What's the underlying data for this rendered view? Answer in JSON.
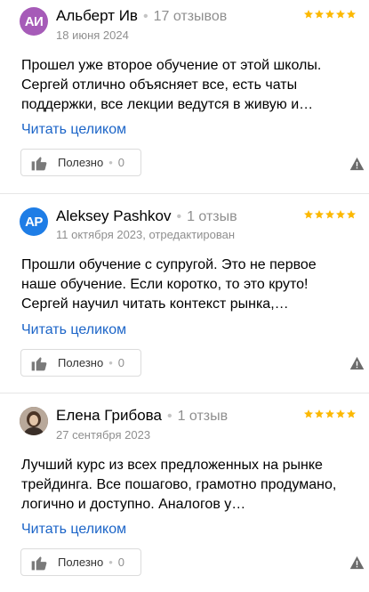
{
  "reviews": [
    {
      "avatar_initials": "АИ",
      "avatar_color": "#a65bb8",
      "author": "Альберт Ив",
      "review_count": "17 отзывов",
      "date": "18 июня 2024",
      "rating": 5,
      "text": "Прошел уже второе обучение от этой школы. Сергей отлично объясняет все, есть чаты поддержки, все лекции ведутся в живую и…",
      "read_more": "Читать целиком",
      "useful_label": "Полезно",
      "useful_count": "0"
    },
    {
      "avatar_initials": "AP",
      "avatar_color": "#1e7de6",
      "author": "Aleksey Pashkov",
      "review_count": "1 отзыв",
      "date": "11 октября 2023, отредактирован",
      "rating": 5,
      "text": "Прошли обучение с супругой. Это не первое наше обучение. Если коротко, то это круто! Сергей научил читать контекст рынка,…",
      "read_more": "Читать целиком",
      "useful_label": "Полезно",
      "useful_count": "0"
    },
    {
      "avatar_initials": "",
      "avatar_color": "#6d5a4a",
      "author": "Елена Грибова",
      "review_count": "1 отзыв",
      "date": "27 сентября 2023",
      "rating": 5,
      "text": "Лучший курс из всех предложенных на рынке трейдинга. Все пошагово, грамотно продумано, логично и доступно. Аналогов у…",
      "read_more": "Читать целиком",
      "useful_label": "Полезно",
      "useful_count": "0"
    }
  ],
  "colors": {
    "star": "#fcb800",
    "link": "#1c65c8",
    "muted": "#8f8f8f"
  },
  "icons": {
    "rating": "star-icon",
    "useful": "thumbs-up-icon",
    "report": "warning-triangle-icon"
  }
}
